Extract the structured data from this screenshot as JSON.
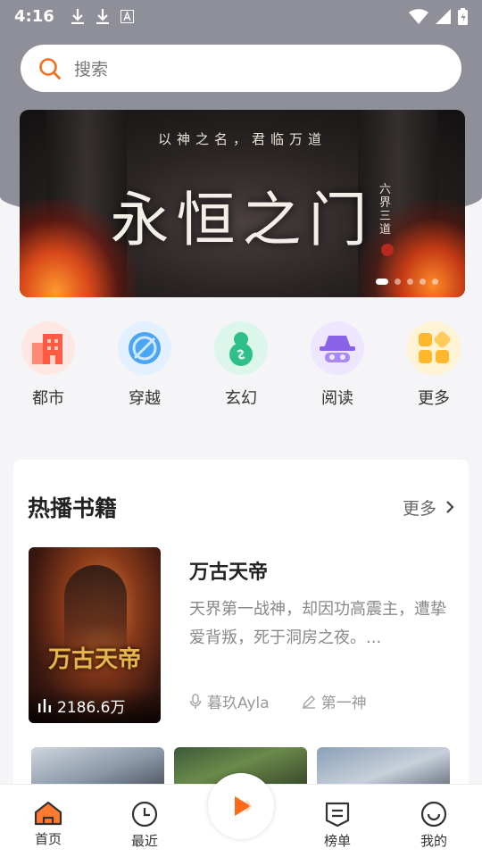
{
  "status_bar": {
    "time": "4:16",
    "left_icons": [
      "download-icon",
      "download-icon",
      "font-icon"
    ],
    "right_icons": [
      "wifi-icon",
      "signal-icon",
      "battery-icon"
    ]
  },
  "search": {
    "placeholder": "搜索"
  },
  "banner": {
    "subtitle": "以神之名，君临万道",
    "title": "永恒之门",
    "side_text": "六界三道",
    "slide_count": 5,
    "active_slide": 1
  },
  "categories": [
    {
      "label": "都市",
      "icon": "city-icon",
      "color": "#ff6b5a"
    },
    {
      "label": "穿越",
      "icon": "portal-icon",
      "color": "#3a9bf0"
    },
    {
      "label": "玄幻",
      "icon": "gourd-icon",
      "color": "#2fbf8a"
    },
    {
      "label": "阅读",
      "icon": "incognito-icon",
      "color": "#8a62e8"
    },
    {
      "label": "更多",
      "icon": "grid-icon",
      "color": "#ffb82e"
    }
  ],
  "hot_books": {
    "title": "热播书籍",
    "more_label": "更多",
    "featured": {
      "cover_title": "万古天帝",
      "play_count": "2186.6万",
      "title": "万古天帝",
      "description": "天界第一战神，却因功高震主，遭挚爱背叛，死于洞房之夜。...",
      "narrator": "暮玖Ayla",
      "author": "第一神"
    }
  },
  "bottom_nav": {
    "items": [
      {
        "label": "首页",
        "icon": "home-icon",
        "active": true
      },
      {
        "label": "最近",
        "icon": "clock-icon",
        "active": false
      },
      {
        "label": "榜单",
        "icon": "chart-list-icon",
        "active": false
      },
      {
        "label": "我的",
        "icon": "smile-icon",
        "active": false
      }
    ]
  },
  "colors": {
    "accent": "#ff6a1a",
    "header_bg": "#8f8f99"
  }
}
